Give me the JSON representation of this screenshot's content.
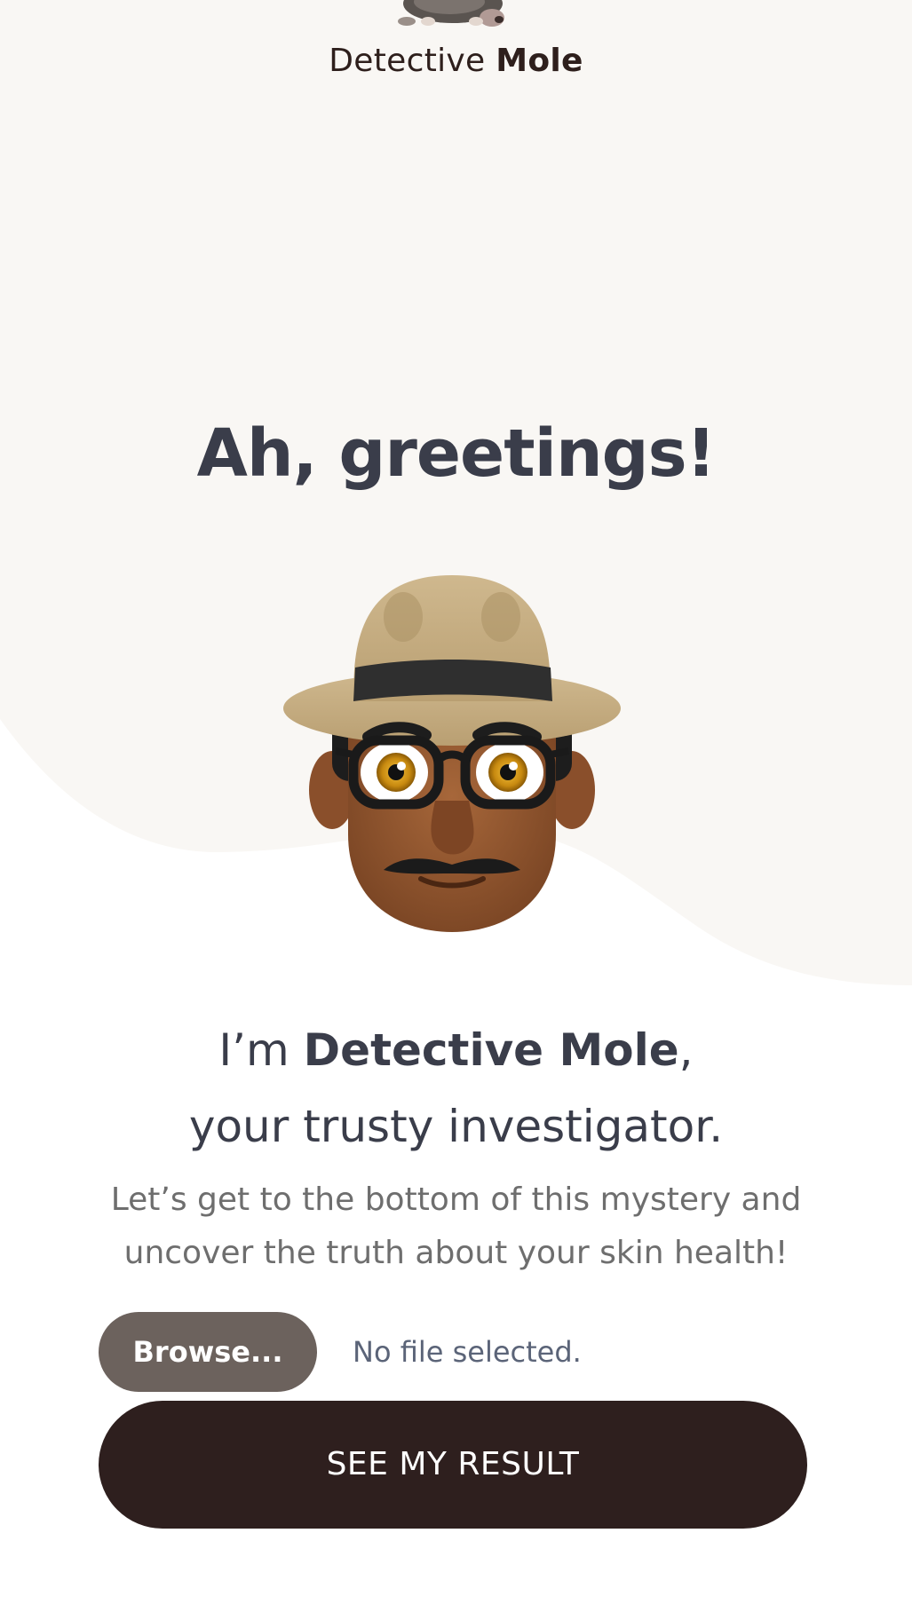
{
  "header": {
    "brand_prefix": "Detective",
    "brand_name": "Mole",
    "logo_icon": "mole-icon"
  },
  "hero": {
    "title": "Ah, greetings!",
    "avatar_icon": "detective-emoji-icon"
  },
  "intro": {
    "prefix": "I’m ",
    "name": "Detective Mole",
    "suffix": ",",
    "line2": "your trusty investigator."
  },
  "description": "Let’s get to the bottom of this mystery and uncover the truth about your skin health!",
  "upload": {
    "browse_label": "Browse...",
    "status": "No file selected."
  },
  "submit": {
    "label": "SEE MY RESULT"
  },
  "colors": {
    "background_blob": "#f9f7f4",
    "primary_button": "#2e1f1e",
    "browse_button": "#6c625d",
    "heading_text": "#3a3d4a"
  }
}
